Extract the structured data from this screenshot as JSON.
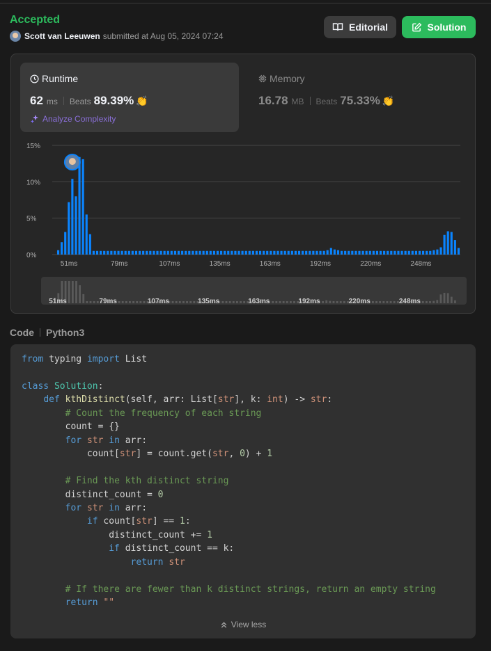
{
  "header": {
    "status": "Accepted",
    "author": "Scott van Leeuwen",
    "submitted_text": "submitted at Aug 05, 2024 07:24",
    "editorial_label": "Editorial",
    "solution_label": "Solution"
  },
  "runtime": {
    "title": "Runtime",
    "value": "62",
    "unit": "ms",
    "beats_label": "Beats",
    "beats_value": "89.39%",
    "analyze_label": "Analyze Complexity"
  },
  "memory": {
    "title": "Memory",
    "value": "16.78",
    "unit": "MB",
    "beats_label": "Beats",
    "beats_value": "75.33%"
  },
  "chart_data": {
    "type": "bar",
    "ylabel": "",
    "xlabel": "",
    "y_ticks": [
      "15%",
      "10%",
      "5%",
      "0%"
    ],
    "ylim": [
      0,
      15
    ],
    "x_ticks": [
      "51ms",
      "79ms",
      "107ms",
      "135ms",
      "163ms",
      "192ms",
      "220ms",
      "248ms"
    ],
    "highlight_index": 4,
    "values": [
      0.6,
      1.7,
      3.1,
      7.2,
      10.4,
      8.0,
      13.4,
      13.1,
      5.5,
      2.8,
      0.5,
      0.5,
      0.5,
      0.5,
      0.5,
      0.5,
      0.5,
      0.5,
      0.5,
      0.5,
      0.5,
      0.5,
      0.5,
      0.5,
      0.5,
      0.5,
      0.5,
      0.5,
      0.5,
      0.5,
      0.5,
      0.5,
      0.5,
      0.5,
      0.5,
      0.5,
      0.5,
      0.5,
      0.5,
      0.5,
      0.5,
      0.5,
      0.5,
      0.5,
      0.5,
      0.5,
      0.5,
      0.5,
      0.5,
      0.5,
      0.5,
      0.5,
      0.5,
      0.5,
      0.5,
      0.5,
      0.5,
      0.5,
      0.5,
      0.5,
      0.5,
      0.5,
      0.5,
      0.5,
      0.5,
      0.5,
      0.5,
      0.5,
      0.5,
      0.5,
      0.5,
      0.5,
      0.5,
      0.5,
      0.5,
      0.5,
      0.6,
      0.9,
      0.7,
      0.6,
      0.5,
      0.5,
      0.5,
      0.5,
      0.5,
      0.5,
      0.5,
      0.5,
      0.5,
      0.5,
      0.5,
      0.5,
      0.5,
      0.5,
      0.5,
      0.5,
      0.5,
      0.5,
      0.5,
      0.5,
      0.5,
      0.5,
      0.5,
      0.5,
      0.5,
      0.5,
      0.6,
      0.7,
      1.0,
      2.7,
      3.2,
      3.1,
      2.0,
      0.9
    ]
  },
  "code": {
    "label": "Code",
    "language": "Python3",
    "view_less": "View less"
  }
}
